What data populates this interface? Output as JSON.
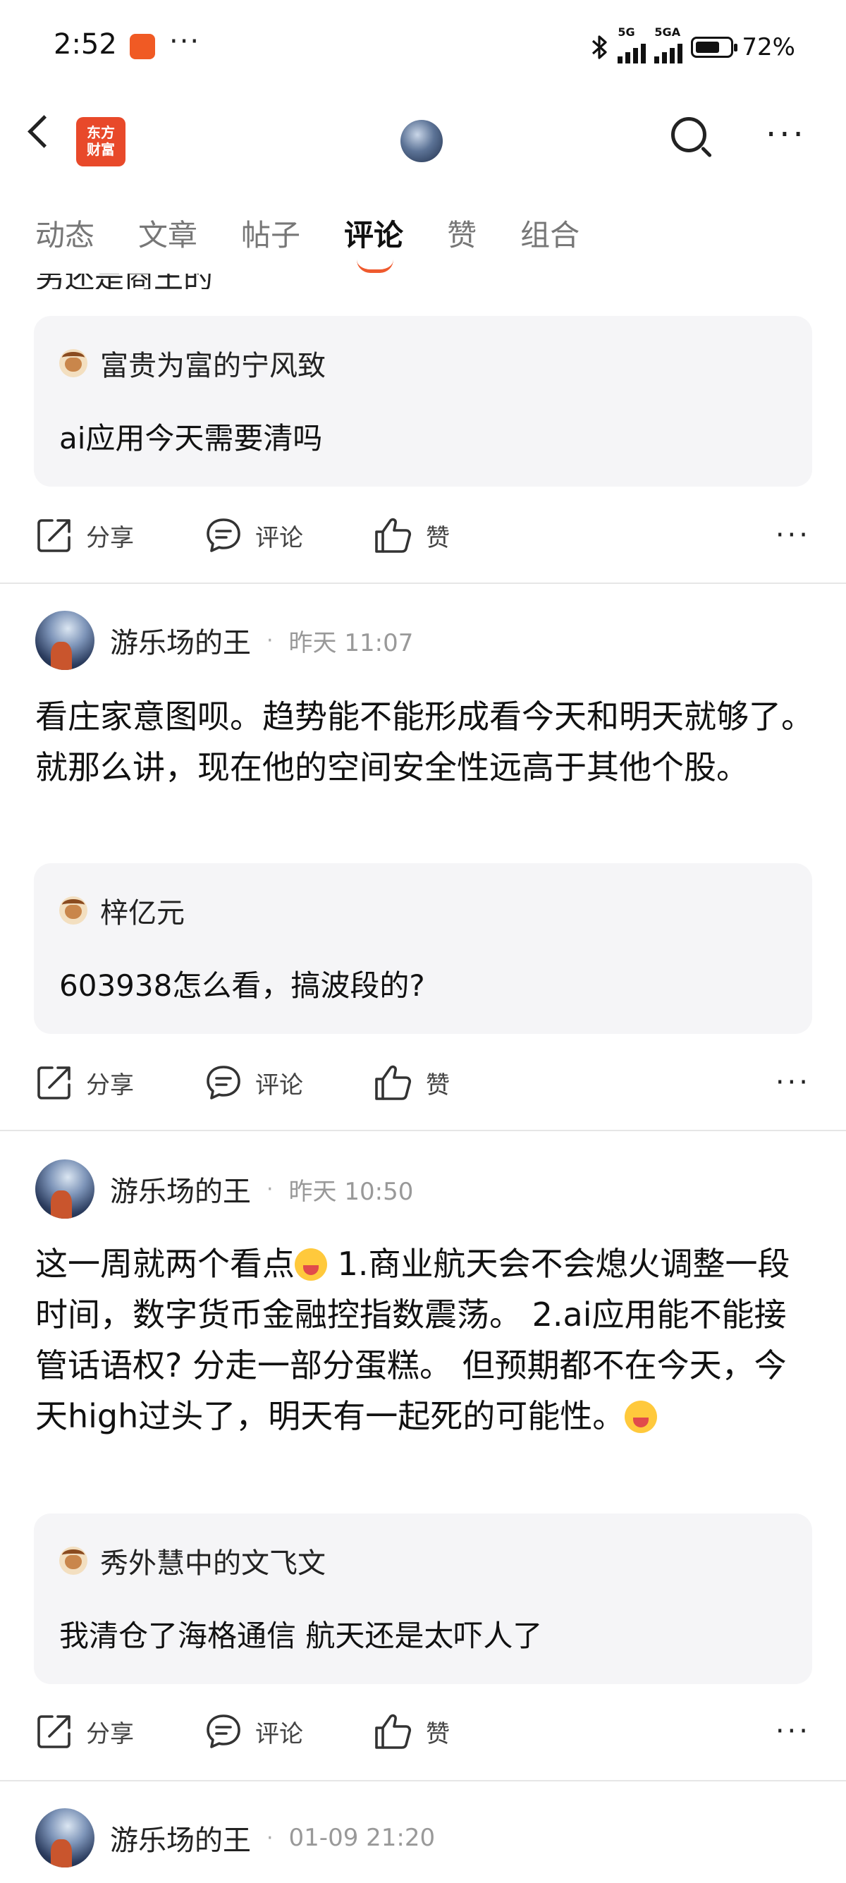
{
  "status_bar": {
    "time": "2:52",
    "dots": "···",
    "net1": "5G",
    "net2": "5GA",
    "battery": "72%",
    "battery_level": 0.72
  },
  "header": {
    "brand_label": "东方财富",
    "more": "···"
  },
  "tabs": [
    "动态",
    "文章",
    "帖子",
    "评论",
    "赞",
    "组合"
  ],
  "active_tab": "评论",
  "clipped_text": "另还是商王的",
  "actions": {
    "share": "分享",
    "comment": "评论",
    "like": "赞",
    "more": "···"
  },
  "items": [
    {
      "quote": {
        "user": "富贵为富的宁风致",
        "text": "ai应用今天需要清吗"
      }
    },
    {
      "author": "游乐场的王",
      "time": "昨天 11:07",
      "content": "看庄家意图呗。趋势能不能形成看今天和明天就够了。就那么讲，现在他的空间安全性远高于其他个股。",
      "quote": {
        "user": "梓亿元",
        "text": "603938怎么看，搞波段的?"
      }
    },
    {
      "author": "游乐场的王",
      "time": "昨天 10:50",
      "content_a": "这一周就两个看点",
      "content_b": "  1.商业航天会不会熄火调整一段时间，数字货币金融控指数震荡。 2.ai应用能不能接管话语权? 分走一部分蛋糕。 但预期都不在今天，今天high过头了，明天有一起死的可能性。",
      "quote": {
        "user": "秀外慧中的文飞文",
        "text": "我清仓了海格通信 航天还是太吓人了"
      }
    },
    {
      "author": "游乐场的王",
      "time": "01-09 21:20"
    }
  ]
}
